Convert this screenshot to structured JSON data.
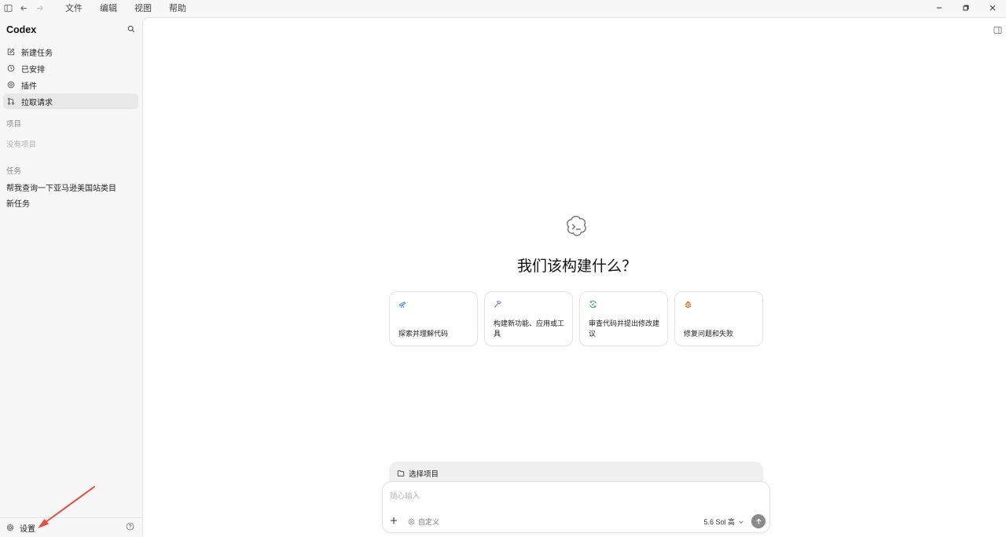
{
  "titlebar": {
    "menu": [
      "文件",
      "编辑",
      "视图",
      "帮助"
    ]
  },
  "sidebar": {
    "app_title": "Codex",
    "nav": [
      {
        "label": "新建任务",
        "icon": "edit-icon"
      },
      {
        "label": "已安排",
        "icon": "clock-icon"
      },
      {
        "label": "插件",
        "icon": "plugin-icon"
      },
      {
        "label": "拉取请求",
        "icon": "pull-request-icon"
      }
    ],
    "projects_heading": "项目",
    "projects_empty": "没有项目",
    "tasks_heading": "任务",
    "tasks": [
      "帮我查询一下亚马逊美国站类目",
      "新任务"
    ],
    "settings_label": "设置"
  },
  "main": {
    "hero_title": "我们该构建什么？",
    "cards": [
      {
        "label": "探索并理解代码",
        "icon": "telescope-icon",
        "color": "#3b82f6"
      },
      {
        "label": "构建新功能、应用或工具",
        "icon": "hammer-icon",
        "color": "#8b5cf6"
      },
      {
        "label": "审查代码并提出修改建议",
        "icon": "review-icon",
        "color": "#22a34a"
      },
      {
        "label": "修复问题和失败",
        "icon": "bug-icon",
        "color": "#ea580c"
      }
    ],
    "project_select_label": "选择项目",
    "composer_placeholder": "随心输入",
    "custom_label": "自定义",
    "model_label": "5.6 Sol 高"
  },
  "colors": {
    "annotation_arrow": "#e84a3c"
  }
}
